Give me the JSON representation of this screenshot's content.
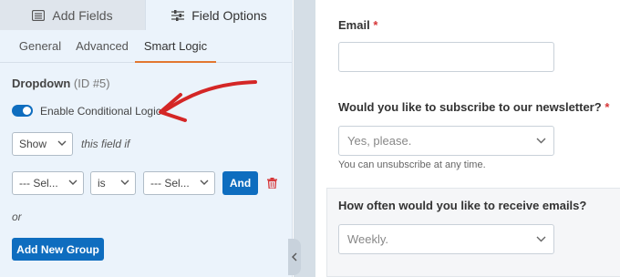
{
  "builder": {
    "top_tabs": [
      {
        "label": "Add Fields",
        "icon": "list-icon"
      },
      {
        "label": "Field Options",
        "icon": "sliders-icon"
      }
    ],
    "sub_tabs": [
      "General",
      "Advanced",
      "Smart Logic"
    ],
    "field_name": "Dropdown",
    "field_id": "(ID #5)",
    "toggle_label": "Enable Conditional Logic",
    "toggle_on": true,
    "show_select": "Show",
    "show_suffix": "this field if",
    "rule": {
      "field_select": "--- Sel...",
      "operator_select": "is",
      "value_select": "--- Sel...",
      "and_label": "And"
    },
    "or_label": "or",
    "add_group_label": "Add New Group"
  },
  "preview": {
    "email_label": "Email",
    "required_mark": "*",
    "newsletter_label": "Would you like to subscribe to our newsletter?",
    "newsletter_value": "Yes, please.",
    "newsletter_help": "You can unsubscribe at any time.",
    "frequency_label": "How often would you like to receive emails?",
    "frequency_value": "Weekly."
  },
  "colors": {
    "accent_blue": "#0e6dbf",
    "tab_underline": "#e27730",
    "arrow_red": "#d42626",
    "required_red": "#d63638"
  }
}
